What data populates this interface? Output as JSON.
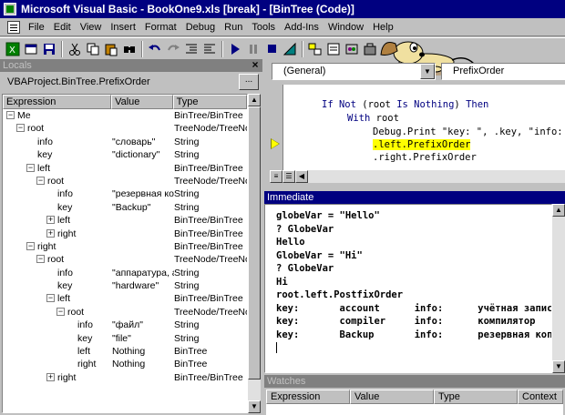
{
  "window": {
    "title": "Microsoft Visual Basic - BookOne9.xls [break] - [BinTree (Code)]"
  },
  "menu": [
    "File",
    "Edit",
    "View",
    "Insert",
    "Format",
    "Debug",
    "Run",
    "Tools",
    "Add-Ins",
    "Window",
    "Help"
  ],
  "locals": {
    "title": "Locals",
    "context": "VBAProject.BinTree.PrefixOrder",
    "context_button": "...",
    "columns": [
      "Expression",
      "Value",
      "Type"
    ],
    "rows": [
      {
        "indent": 0,
        "box": "−",
        "name": "Me",
        "value": "",
        "type": "BinTree/BinTree"
      },
      {
        "indent": 1,
        "box": "−",
        "name": "root",
        "value": "",
        "type": "TreeNode/TreeNode"
      },
      {
        "indent": 2,
        "box": "",
        "name": "info",
        "value": "\"словарь\"",
        "type": "String"
      },
      {
        "indent": 2,
        "box": "",
        "name": "key",
        "value": "\"dictionary\"",
        "type": "String"
      },
      {
        "indent": 2,
        "box": "−",
        "name": "left",
        "value": "",
        "type": "BinTree/BinTree"
      },
      {
        "indent": 3,
        "box": "−",
        "name": "root",
        "value": "",
        "type": "TreeNode/TreeNode"
      },
      {
        "indent": 4,
        "box": "",
        "name": "info",
        "value": "\"резервная копия\"",
        "type": "String"
      },
      {
        "indent": 4,
        "box": "",
        "name": "key",
        "value": "\"Backup\"",
        "type": "String"
      },
      {
        "indent": 4,
        "box": "+",
        "name": "left",
        "value": "",
        "type": "BinTree/BinTree"
      },
      {
        "indent": 4,
        "box": "+",
        "name": "right",
        "value": "",
        "type": "BinTree/BinTree"
      },
      {
        "indent": 2,
        "box": "−",
        "name": "right",
        "value": "",
        "type": "BinTree/BinTree"
      },
      {
        "indent": 3,
        "box": "−",
        "name": "root",
        "value": "",
        "type": "TreeNode/TreeNode"
      },
      {
        "indent": 4,
        "box": "",
        "name": "info",
        "value": "\"аппаратура, аппаратные средства\"",
        "type": "String"
      },
      {
        "indent": 4,
        "box": "",
        "name": "key",
        "value": "\"hardware\"",
        "type": "String"
      },
      {
        "indent": 4,
        "box": "−",
        "name": "left",
        "value": "",
        "type": "BinTree/BinTree"
      },
      {
        "indent": 5,
        "box": "−",
        "name": "root",
        "value": "",
        "type": "TreeNode/TreeNode"
      },
      {
        "indent": 6,
        "box": "",
        "name": "info",
        "value": "\"файл\"",
        "type": "String"
      },
      {
        "indent": 6,
        "box": "",
        "name": "key",
        "value": "\"file\"",
        "type": "String"
      },
      {
        "indent": 6,
        "box": "",
        "name": "left",
        "value": "Nothing",
        "type": "BinTree"
      },
      {
        "indent": 6,
        "box": "",
        "name": "right",
        "value": "Nothing",
        "type": "BinTree"
      },
      {
        "indent": 4,
        "box": "+",
        "name": "right",
        "value": "",
        "type": "BinTree/BinTree"
      }
    ]
  },
  "code": {
    "object_combo": "(General)",
    "proc_combo": "PrefixOrder",
    "lines": [
      {
        "kw1": "If Not",
        "mid": " (root ",
        "kw2": "Is Nothing",
        "tail": ") ",
        "kw3": "Then"
      },
      {
        "kw1": "With",
        "mid": " root",
        "kw2": "",
        "tail": "",
        "kw3": ""
      }
    ],
    "line3": "Debug.Print \"key: \", .key, \"info: \", .info",
    "line4_highlight": ".left.PrefixOrder",
    "line5": ".right.PrefixOrder"
  },
  "immediate": {
    "title": "Immediate",
    "lines": [
      "globeVar = \"Hello\"",
      "? GlobeVar",
      "Hello",
      "GlobeVar = \"Hi\"",
      "? GlobeVar",
      "Hi",
      "root.left.PostfixOrder",
      "key:       account      info:      учётная запись",
      "key:       compiler     info:      компилятор",
      "key:       Backup       info:      резервная копия",
      ""
    ]
  },
  "watches": {
    "title": "Watches",
    "columns": [
      "Expression",
      "Value",
      "Type",
      "Context"
    ]
  }
}
